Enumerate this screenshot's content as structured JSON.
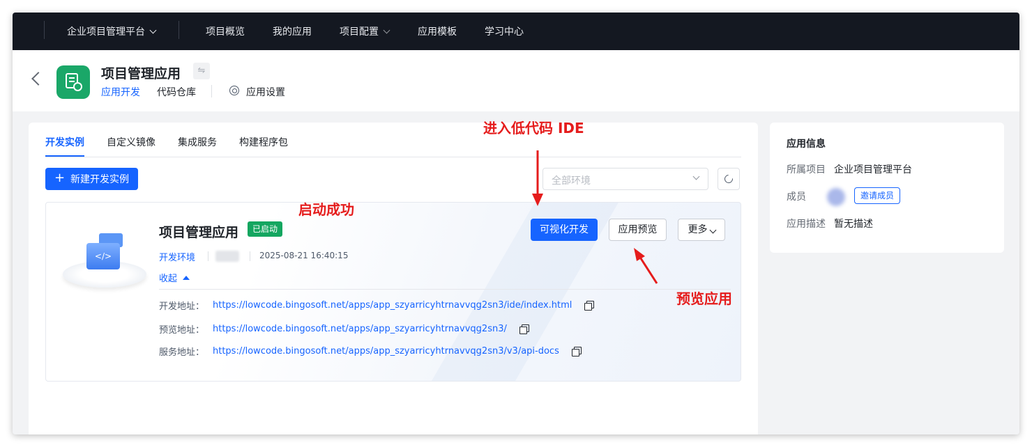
{
  "topnav": {
    "platform": "企业项目管理平台",
    "items": [
      "项目概览",
      "我的应用",
      "项目配置",
      "应用模板",
      "学习中心"
    ]
  },
  "app": {
    "title": "项目管理应用",
    "subtabs": [
      "应用开发",
      "代码仓库",
      "应用设置"
    ]
  },
  "tabs": [
    "开发实例",
    "自定义镜像",
    "集成服务",
    "构建程序包"
  ],
  "toolbar": {
    "new_label": "新建开发实例",
    "env_placeholder": "全部环境"
  },
  "instance": {
    "title": "项目管理应用",
    "status": "已启动",
    "env": "开发环境",
    "timestamp": "2025-08-21 16:40:15",
    "collapse": "收起",
    "btn_visual": "可视化开发",
    "btn_preview": "应用预览",
    "btn_more": "更多",
    "addresses": [
      {
        "label": "开发地址：",
        "url": "https://lowcode.bingosoft.net/apps/app_szyarricyhtrnavvqg2sn3/ide/index.html"
      },
      {
        "label": "预览地址：",
        "url": "https://lowcode.bingosoft.net/apps/app_szyarricyhtrnavvqg2sn3/"
      },
      {
        "label": "服务地址：",
        "url": "https://lowcode.bingosoft.net/apps/app_szyarricyhtrnavvqg2sn3/v3/api-docs"
      }
    ]
  },
  "side": {
    "title": "应用信息",
    "project_label": "所属项目",
    "project_value": "企业项目管理平台",
    "member_label": "成员",
    "invite": "邀请成员",
    "desc_label": "应用描述",
    "desc_value": "暂无描述"
  },
  "annotations": {
    "ide": "进入低代码 IDE",
    "started": "启动成功",
    "preview": "预览应用"
  },
  "colors": {
    "accent": "#1664ff",
    "success": "#14a660",
    "annotation": "#e51c1c",
    "nav_bg": "#141821"
  }
}
